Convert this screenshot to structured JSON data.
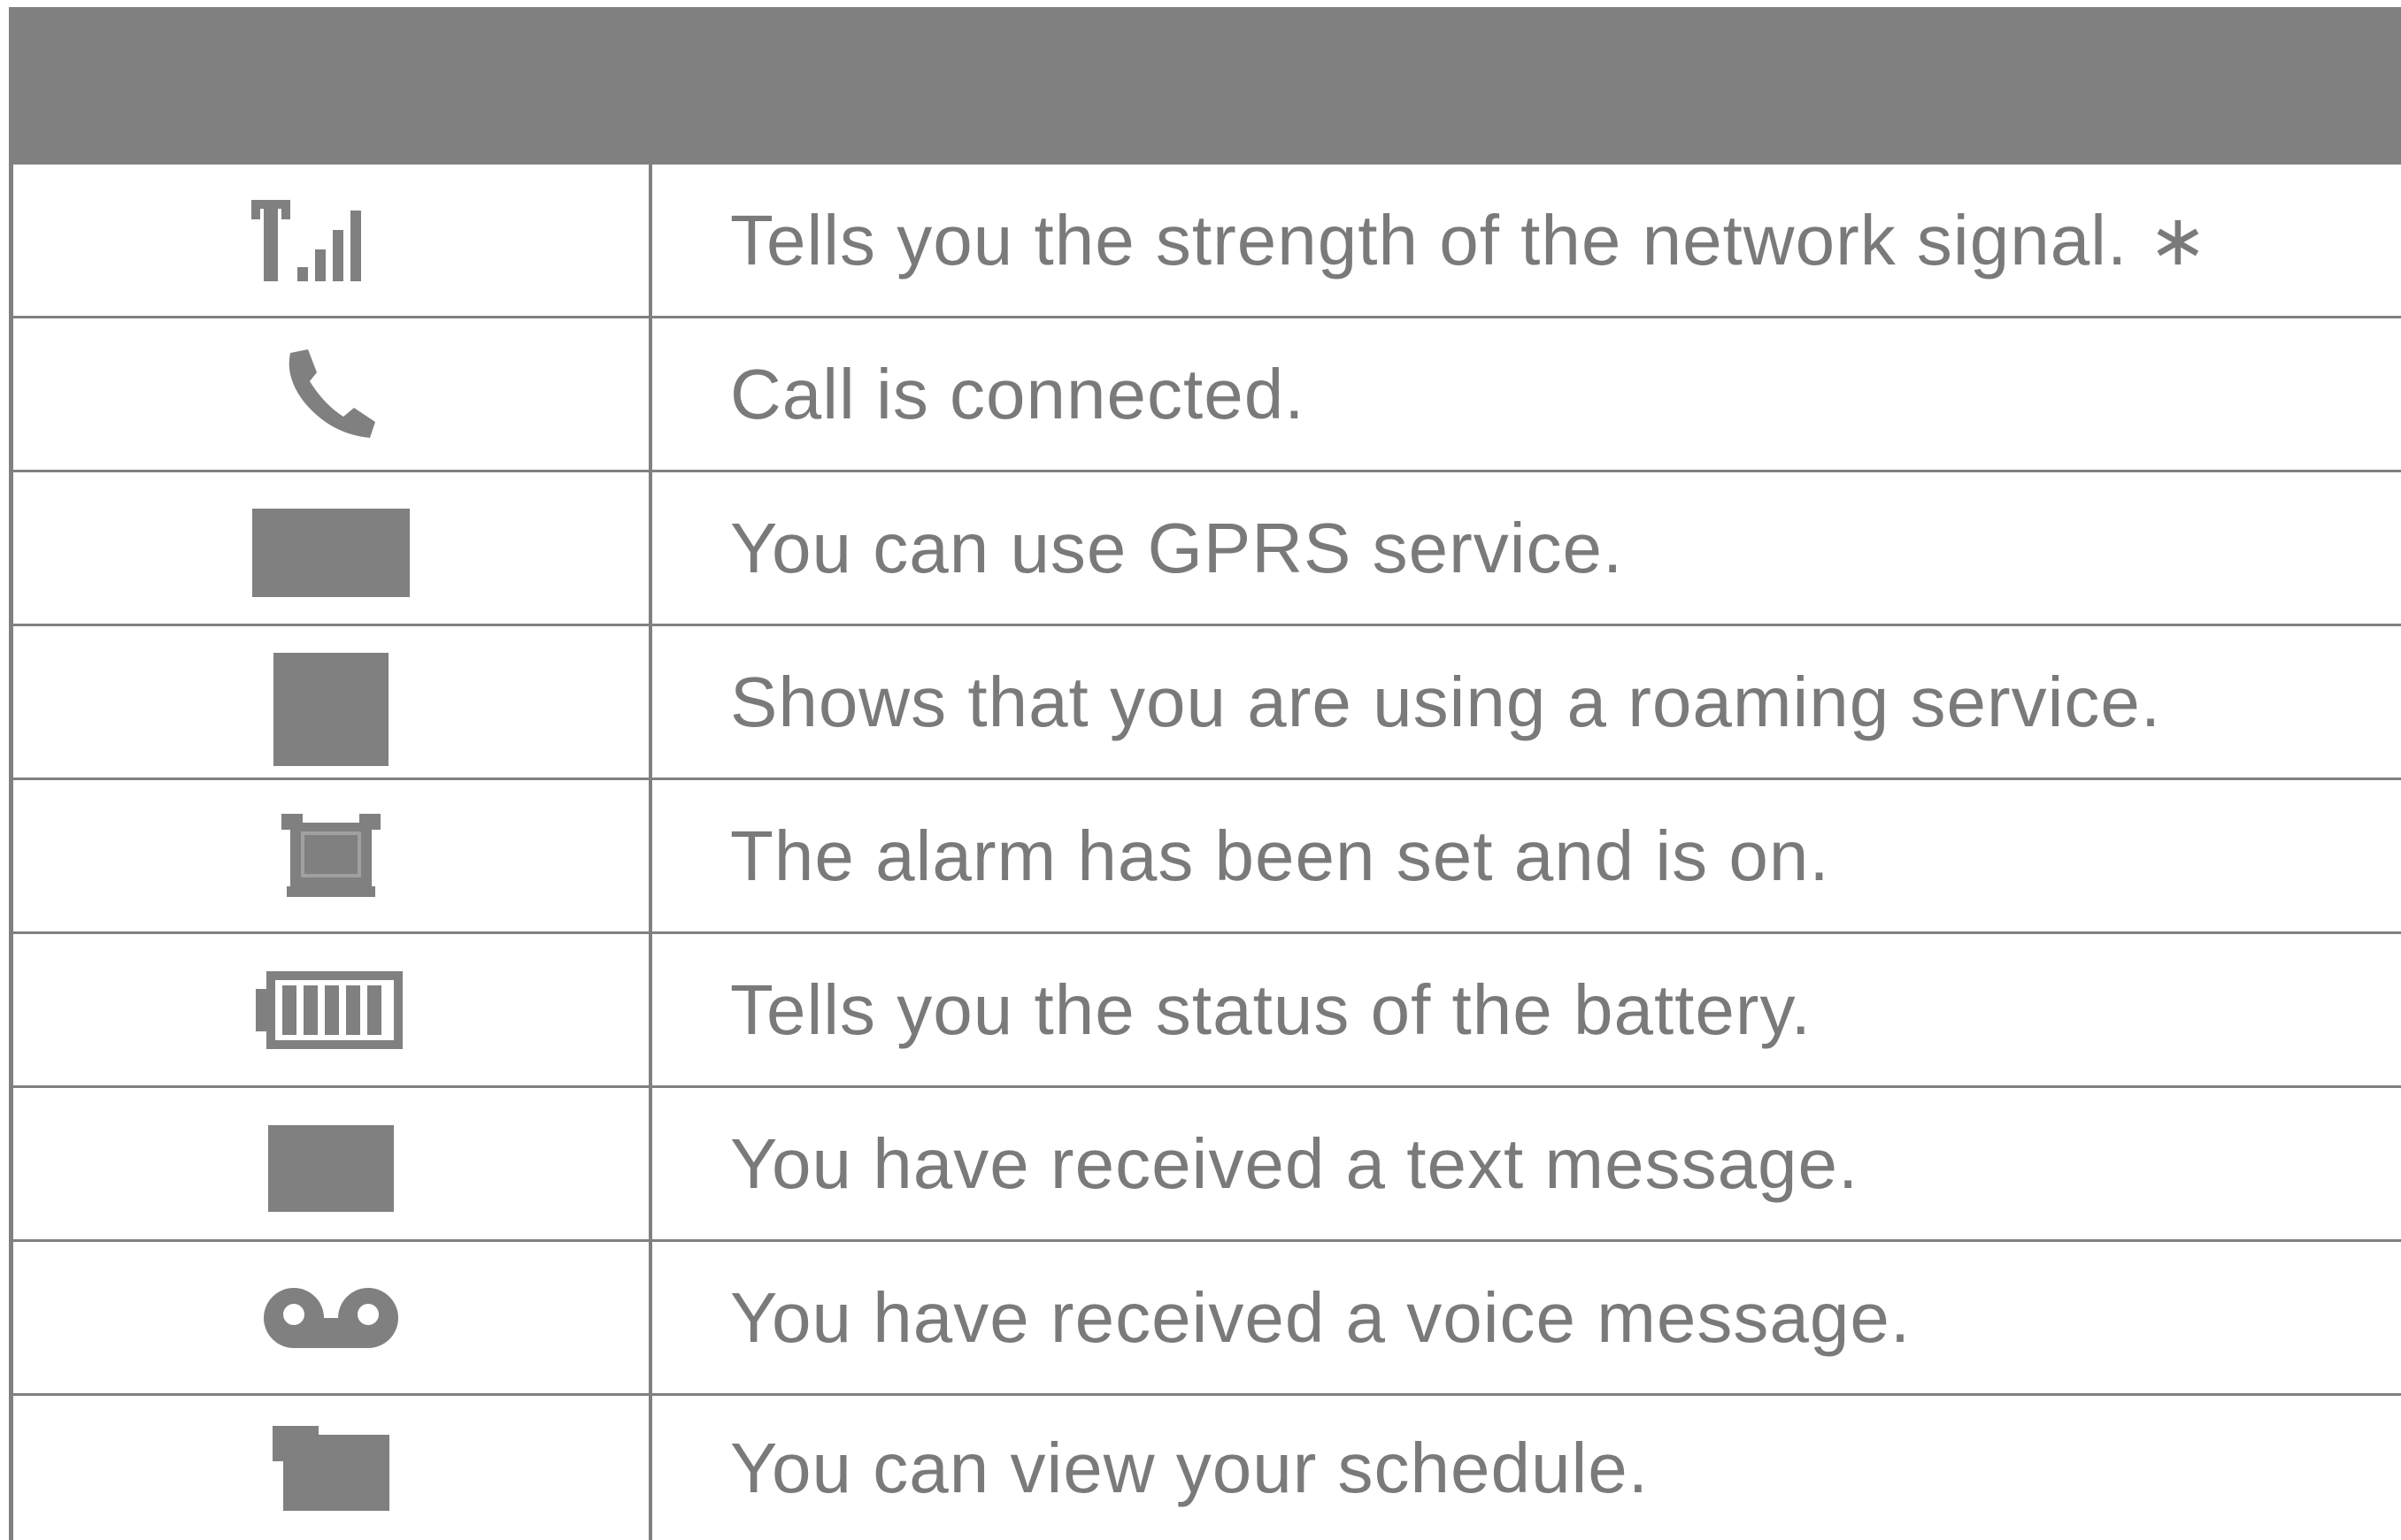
{
  "table": {
    "header": "",
    "rows": [
      {
        "icon": "signal-strength-icon",
        "description": "Tells you the strength of the network signal. ∗"
      },
      {
        "icon": "call-connected-icon",
        "description": "Call is connected."
      },
      {
        "icon": "gprs-icon",
        "description": "You can use GPRS service."
      },
      {
        "icon": "roaming-icon",
        "description": "Shows that you are using a roaming service."
      },
      {
        "icon": "alarm-icon",
        "description": "The alarm has been set and is on."
      },
      {
        "icon": "battery-icon",
        "description": "Tells you the status of the battery."
      },
      {
        "icon": "text-message-icon",
        "description": "You have received a text message."
      },
      {
        "icon": "voice-message-icon",
        "description": "You have received a voice message."
      },
      {
        "icon": "schedule-icon",
        "description": "You can view your schedule."
      }
    ]
  },
  "colors": {
    "grid": "#808080",
    "text": "#7a7a7a",
    "background": "#ffffff"
  }
}
